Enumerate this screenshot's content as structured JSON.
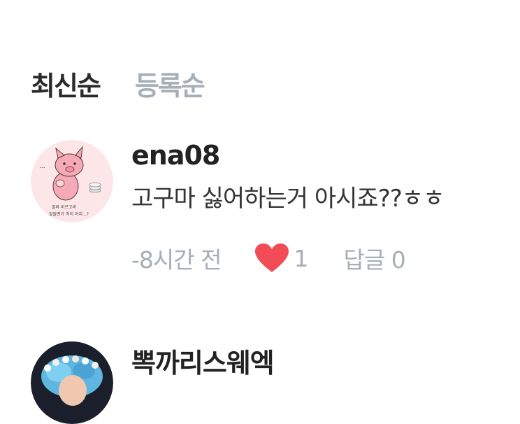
{
  "sort_tabs": {
    "latest": "최신순",
    "registered": "등록순"
  },
  "comments": [
    {
      "username": "ena08",
      "text": "고구마 싫어하는거 아시죠??ㅎㅎ",
      "time": "-8시간 전",
      "like_count": "1",
      "reply_label": "답글 0",
      "avatar_caption_line1": "꿀바 바르고바",
      "avatar_caption_line2": "잘돌면가 먹이 어지...?",
      "avatar_dots": "..."
    },
    {
      "username": "뽁까리스웨엑"
    }
  ],
  "colors": {
    "accent_heart": "#f24c57",
    "muted": "#a6aeb8",
    "text": "#222222"
  }
}
